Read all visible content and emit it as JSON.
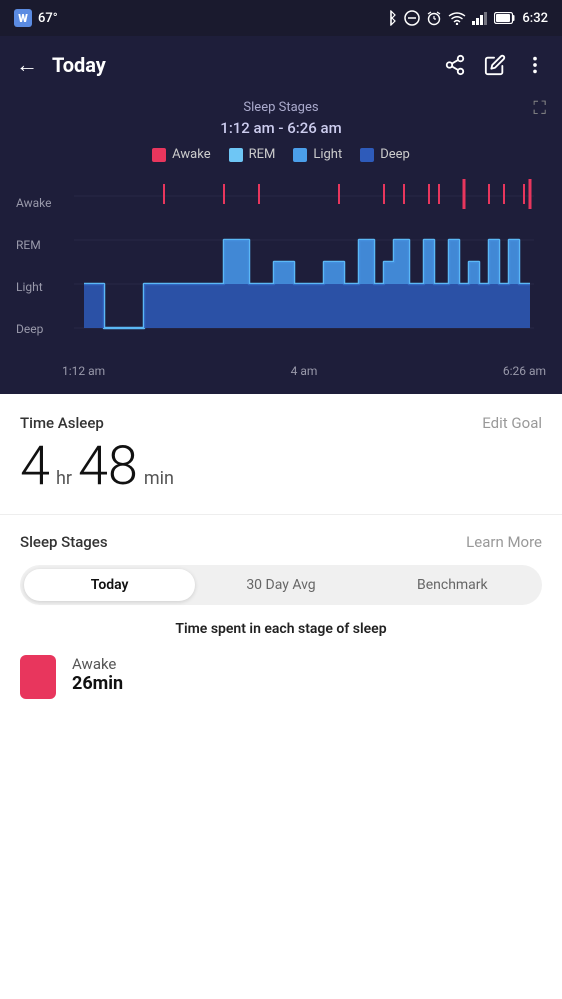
{
  "statusBar": {
    "appIcon": "W",
    "temperature": "67°",
    "time": "6:32",
    "icons": [
      "bluetooth",
      "minus-circle",
      "alarm",
      "wifi",
      "signal",
      "battery"
    ]
  },
  "nav": {
    "title": "Today",
    "backLabel": "←",
    "shareIcon": "share",
    "editIcon": "edit",
    "moreIcon": "more"
  },
  "chartSection": {
    "headerLabel": "Sleep Stages",
    "timeRange": "1:12 am - 6:26 am",
    "legend": [
      {
        "label": "Awake",
        "color": "#e8365d"
      },
      {
        "label": "REM",
        "color": "#6ec6f5"
      },
      {
        "label": "Light",
        "color": "#4b9fea"
      },
      {
        "label": "Deep",
        "color": "#2e5bba"
      }
    ],
    "yLabels": [
      "Awake",
      "REM",
      "Light",
      "Deep"
    ],
    "xLabels": [
      "1:12 am",
      "4 am",
      "6:26 am"
    ]
  },
  "timeAsleep": {
    "label": "Time Asleep",
    "editGoalLabel": "Edit Goal",
    "hours": "4",
    "hrUnit": "hr",
    "minutes": "48",
    "minUnit": "min"
  },
  "sleepStages": {
    "label": "Sleep Stages",
    "learnMoreLabel": "Learn More",
    "tabs": [
      {
        "label": "Today",
        "active": true
      },
      {
        "label": "30 Day Avg",
        "active": false
      },
      {
        "label": "Benchmark",
        "active": false
      }
    ],
    "subtitle": "Time spent in each stage of sleep",
    "stages": [
      {
        "name": "Awake",
        "value": "26min",
        "color": "#e8365d"
      }
    ]
  }
}
